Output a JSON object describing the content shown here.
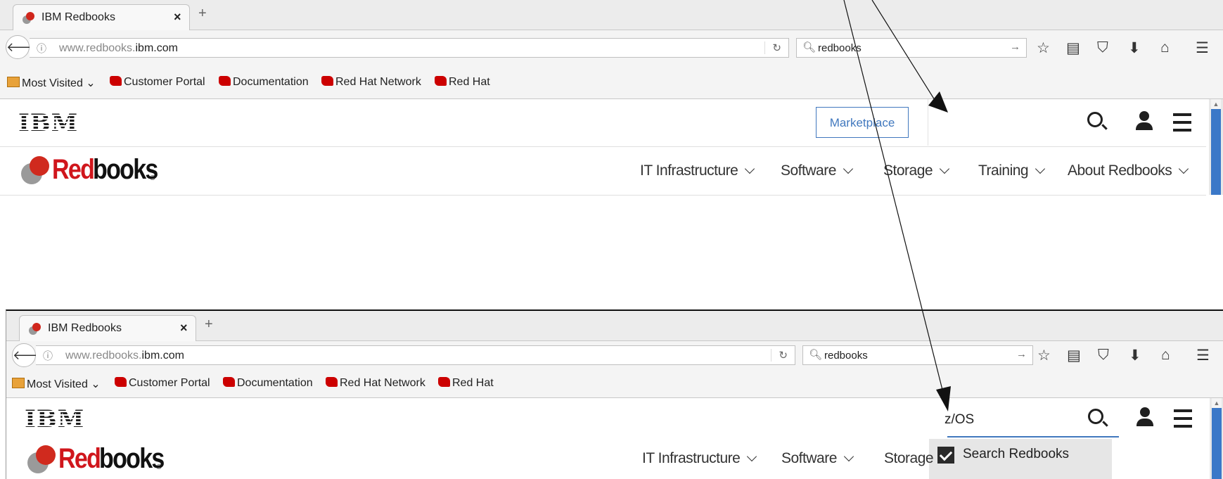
{
  "browser": {
    "tab_title": "IBM Redbooks",
    "tab_close": "×",
    "new_tab": "+",
    "url_prefix": "www.redbooks.",
    "url_domain": "ibm.com",
    "search_value": "redbooks",
    "bookmarks": [
      "Most Visited",
      "Customer Portal",
      "Documentation",
      "Red Hat Network",
      "Red Hat"
    ]
  },
  "site": {
    "ibm_logo": "IBM",
    "marketplace_label": "Marketplace",
    "redbooks_red": "Red",
    "redbooks_black": "books",
    "redbooks_reg": "®",
    "menu": [
      "IT Infrastructure",
      "Software",
      "Storage",
      "Training",
      "About Redbooks"
    ],
    "menu_truncated_storage": "Storage"
  },
  "search_overlay": {
    "query": "z/OS",
    "option_label": "Search Redbooks"
  },
  "colors": {
    "accent_blue": "#4178be",
    "redbooks_red": "#d0161c"
  }
}
